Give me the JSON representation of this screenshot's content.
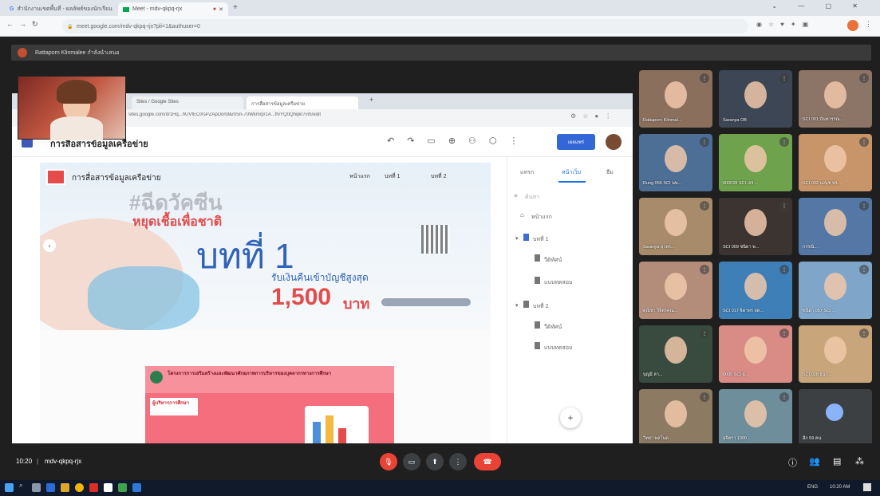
{
  "browser": {
    "tabs": [
      {
        "label": "สำนักงานเขตพื้นที่ - ผลลัพธ์ของนักเรียน",
        "favicon": "G"
      },
      {
        "label": "Meet - mdv-qkpq-rjx",
        "favicon": "meet-icon"
      }
    ],
    "url": "meet.google.com/mdv-qkpq-rjx?pli=1&authuser=0"
  },
  "meet": {
    "presenter_label": "Rattaporn Klinmalee กำลังนำเสนอ",
    "meeting_time": "10:20",
    "meeting_code": "mdv-qkpq-rjx"
  },
  "shared_screen": {
    "inner_tabs": [
      "Sites / Google Sites",
      "การสื่อสารข้อมูลเครือข่าย"
    ],
    "inner_url": "sites.google.com/d/1Hq...hUVfEOXsPZApDon9&mSn-70Wkm/p/1A...ffvYQ0Qhqkr7vm/edit",
    "doc_title": "การสื่อสารข้อมูลเครือข่าย",
    "publish_button": "เผยแพร่",
    "site_title": "การสื่อสารข้อมูลเครือข่าย",
    "site_nav": [
      "หน้าแรก",
      "บทที่ 1",
      "บทที่ 2"
    ],
    "banner_headline": "#ฉีดวัคซีน",
    "banner_sub": "หยุดเชื้อเพื่อชาติ",
    "chapter_title": "บทที่ 1",
    "cashback_text": "รับเงินคืนเข้าบัญชีสูงสุด",
    "amount": "1,500",
    "amount_unit": "บาท",
    "card_title": "โครงการการเสริมสร้างและพัฒนาศักยภาพการบริหารของบุคลากรทางการศึกษา",
    "card_tag": "ผู้บริหารการศึกษา",
    "panel_tabs": [
      "แทรก",
      "หน้าเว็บ",
      "ธีม"
    ],
    "panel_search": "ค้นหา",
    "pages": [
      "หน้าแรก",
      "บทที่ 1",
      "วีดิทัศน์",
      "แบบทดสอบ",
      "บทที่ 2",
      "วีดิทัศน์",
      "แบบทดสอบ"
    ]
  },
  "participants": [
    {
      "name": "Rattaporn Klinmal...",
      "bg": "#8a6f5c"
    },
    {
      "name": "Saranya OB",
      "bg": "#3c4654"
    },
    {
      "name": "SCI 001 นันทวรรณ...",
      "bg": "#8c7466"
    },
    {
      "name": "Rung 056 SCI นพ...",
      "bg": "#4d6e95"
    },
    {
      "name": "000028 SCI เจร...",
      "bg": "#6fa24c"
    },
    {
      "name": "SCI 002 นงนุช ฟร...",
      "bg": "#c79569"
    },
    {
      "name": "Saranya ยุวพร...",
      "bg": "#a88b6a"
    },
    {
      "name": "SCI 009 ชนิดา พ...",
      "bg": "#3b3430"
    },
    {
      "name": "กรรณิ...",
      "bg": "#5477a6"
    },
    {
      "name": "ตุณิชา วิจิตรคุณ...",
      "bg": "#b38d7a"
    },
    {
      "name": "SCI 017 จิดาพร ลด...",
      "bg": "#3f7fb8"
    },
    {
      "name": "ชนิดา 057 SCI ...",
      "bg": "#7fa6c9"
    },
    {
      "name": "บุญมี ลา...",
      "bg": "#394b3e"
    },
    {
      "name": "0000 SCI ฝ...",
      "bg": "#d98b86"
    },
    {
      "name": "SCI 028 ธนา...",
      "bg": "#c9a57b"
    },
    {
      "name": "วิทยา พลโนด",
      "bg": "#8c7a62"
    },
    {
      "name": "สุจิตรา 1000...",
      "bg": "#6e8e9b"
    },
    {
      "name": "อีก 59 คน",
      "bg": "#3c4043"
    }
  ],
  "taskbar": {
    "lang": "ENG",
    "clock": "10:20 AM"
  }
}
